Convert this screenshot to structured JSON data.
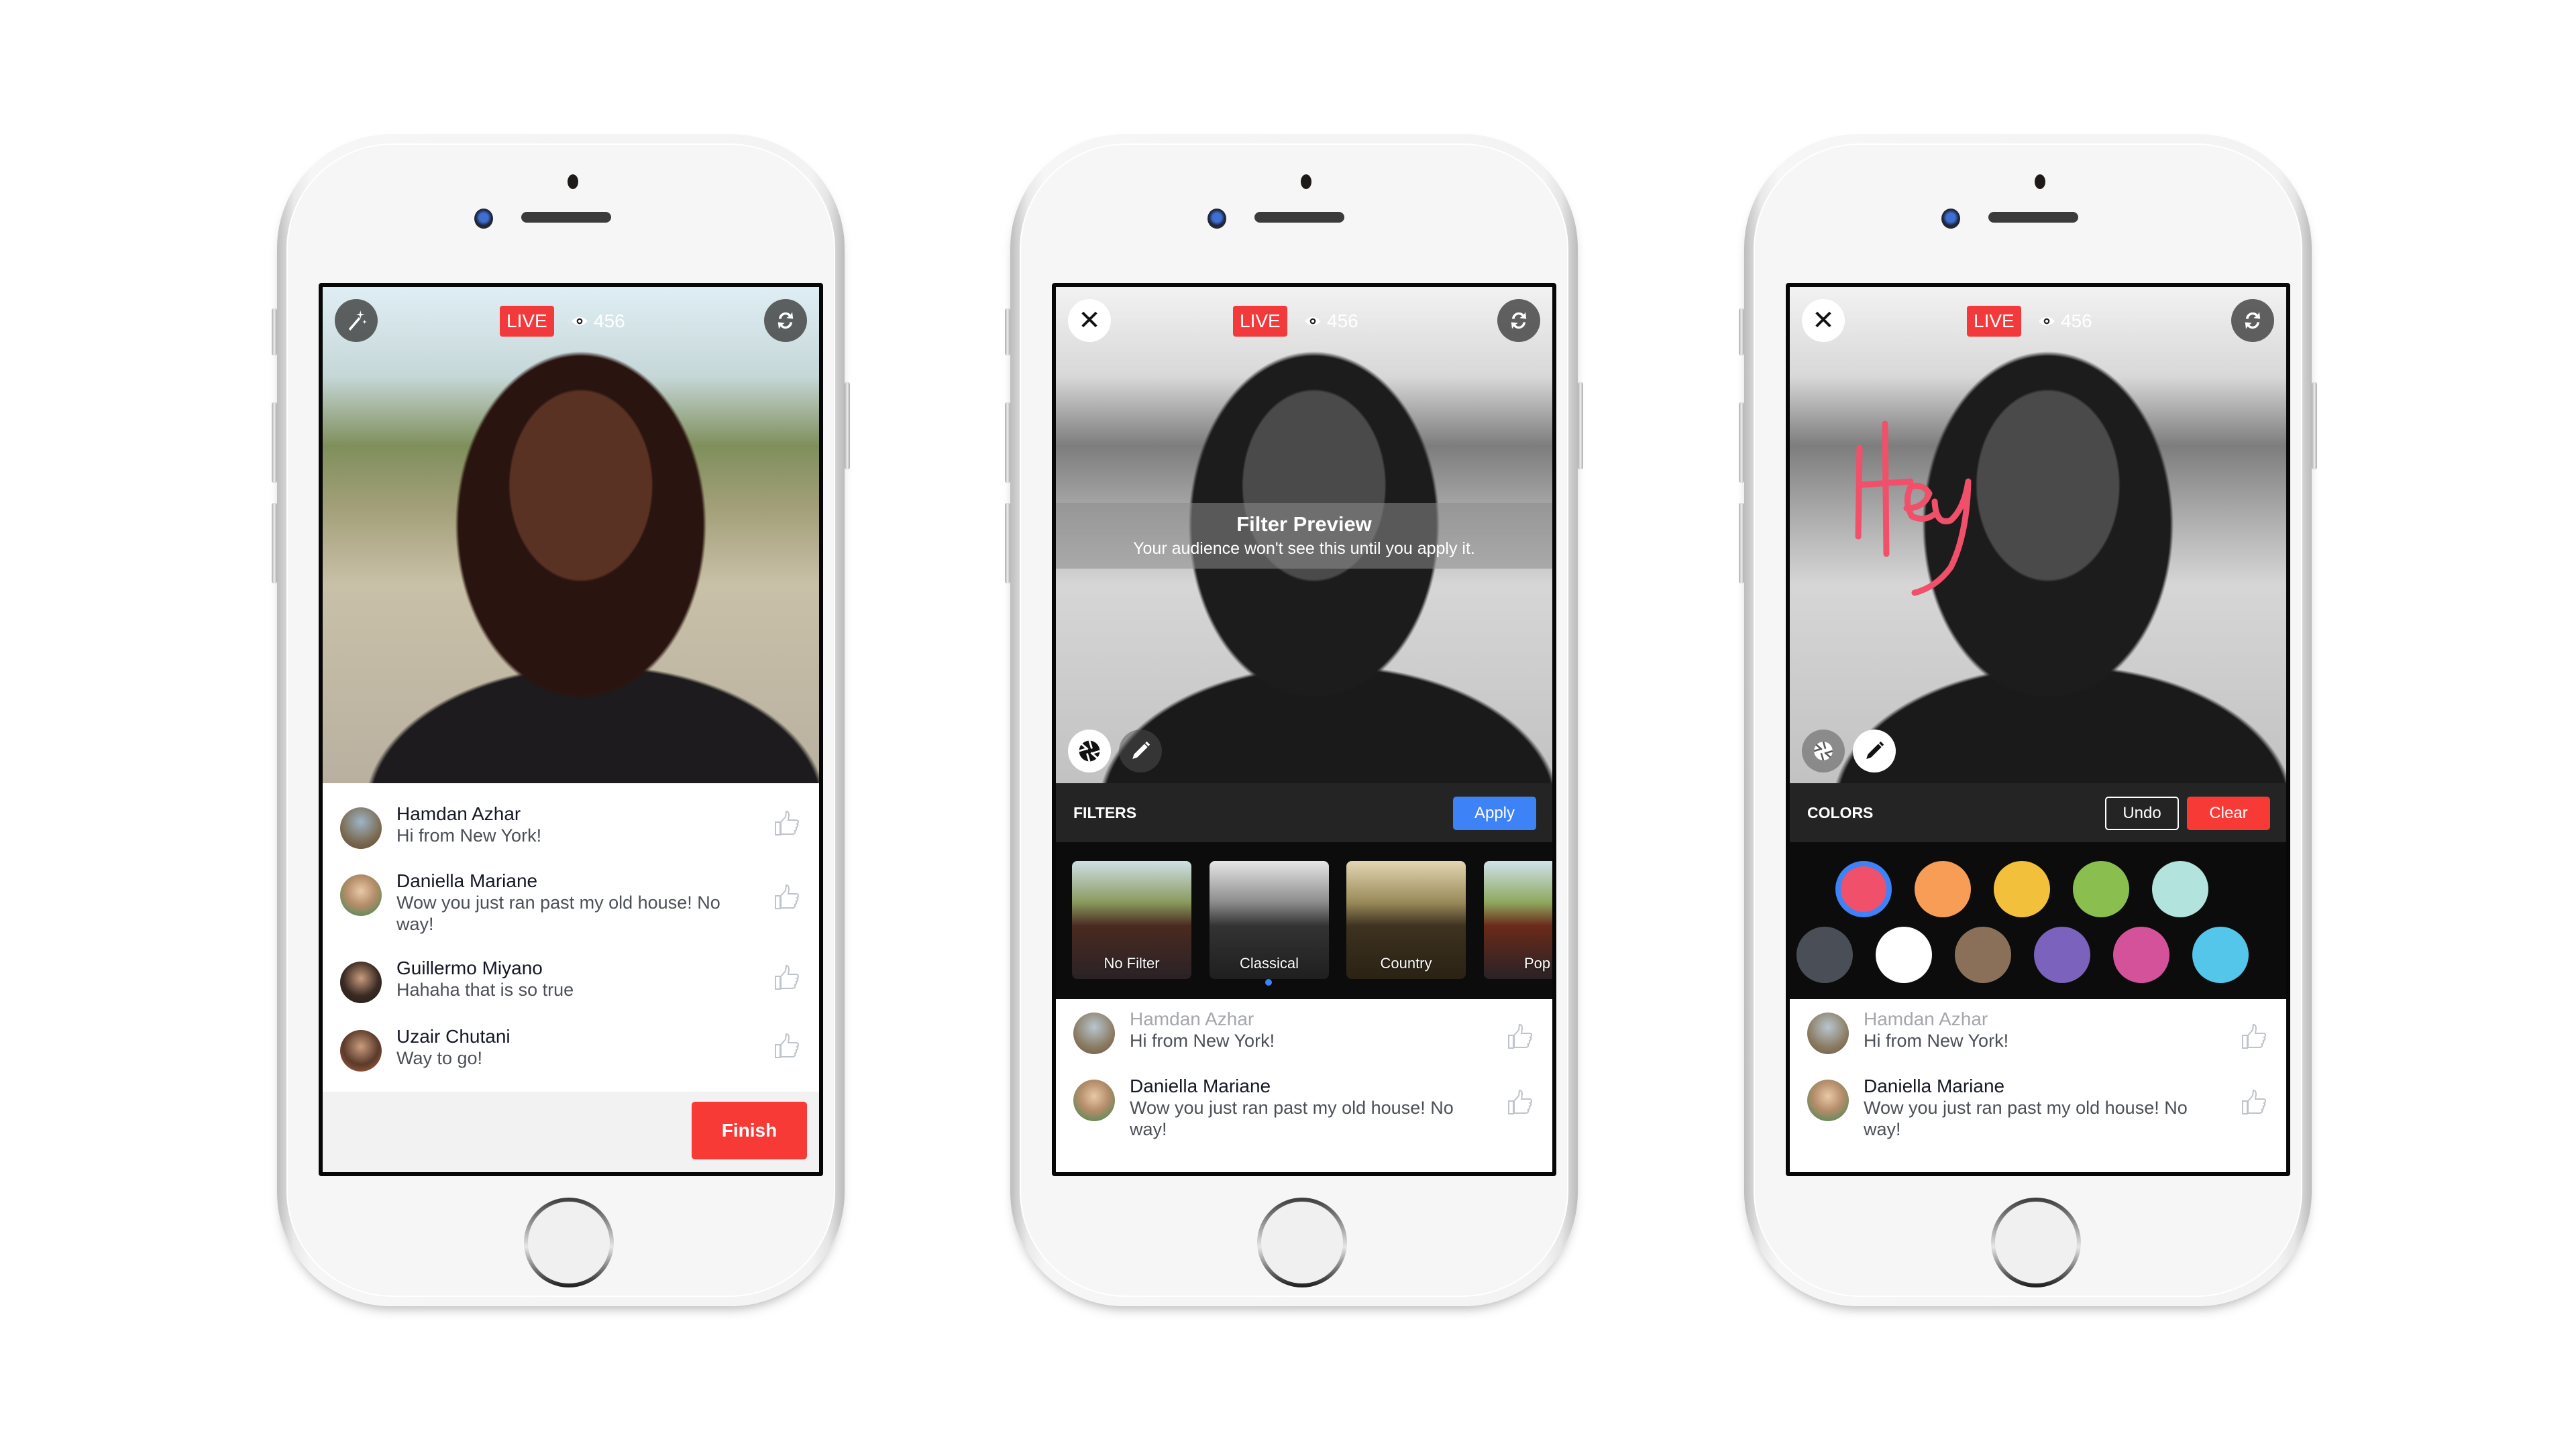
{
  "live_label": "LIVE",
  "viewer_count": "456",
  "icons": {
    "effects": "magic-wand-icon",
    "flip_camera": "flip-camera-icon",
    "close": "close-icon",
    "filters": "shutter-icon",
    "draw": "pencil-icon",
    "viewers": "eye-icon",
    "like": "thumbs-up-icon"
  },
  "colors": {
    "live": "#f23a3c",
    "apply": "#3d82f6",
    "finish": "#f83a36",
    "clear": "#f83a36",
    "drawing": "#f0506a"
  },
  "phone1": {
    "comments": [
      {
        "name": "Hamdan Azhar",
        "message": "Hi from New York!"
      },
      {
        "name": "Daniella Mariane",
        "message": "Wow you just ran past my old house! No way!"
      },
      {
        "name": "Guillermo Miyano",
        "message": "Hahaha that is so true"
      },
      {
        "name": "Uzair Chutani",
        "message": "Way to go!"
      }
    ],
    "finish_label": "Finish"
  },
  "phone2": {
    "preview_title": "Filter Preview",
    "preview_subtitle": "Your audience won't see this until you apply it.",
    "toolbar_label": "FILTERS",
    "apply_label": "Apply",
    "filters": [
      {
        "label": "No Filter"
      },
      {
        "label": "Classical"
      },
      {
        "label": "Country"
      },
      {
        "label": "Pop"
      }
    ],
    "page_index": 1,
    "comments": [
      {
        "name": "Hamdan Azhar",
        "message": "Hi from New York!"
      },
      {
        "name": "Daniella Mariane",
        "message": "Wow you just ran past my old house! No way!"
      }
    ]
  },
  "phone3": {
    "drawing_text": "Hey",
    "toolbar_label": "COLORS",
    "undo_label": "Undo",
    "clear_label": "Clear",
    "swatches_row1": [
      "#f0506a",
      "#f79d55",
      "#f3c03b",
      "#8abe4f",
      "#b2e3dc"
    ],
    "swatches_row2": [
      "#4a4f57",
      "#ffffff",
      "#8a7059",
      "#7a62bd",
      "#d3529a",
      "#53c6ea"
    ],
    "selected_swatch": "#f0506a",
    "comments": [
      {
        "name": "Hamdan Azhar",
        "message": "Hi from New York!"
      },
      {
        "name": "Daniella Mariane",
        "message": "Wow you just ran past my old house! No way!"
      }
    ]
  }
}
